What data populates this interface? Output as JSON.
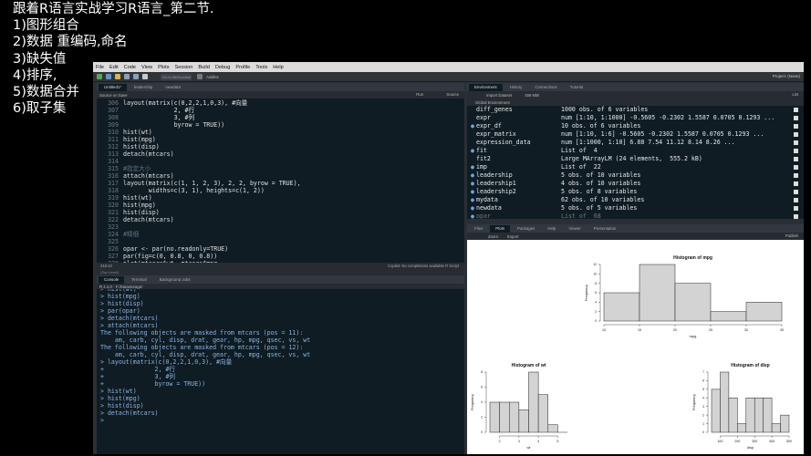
{
  "outline": {
    "title": "跟着R语言实战学习R语言_第二节.",
    "items": [
      "1)图形组合",
      "2)数据 重编码,命名",
      "3)缺失值",
      "4)排序,",
      "5)数据合并",
      "6)取子集"
    ]
  },
  "menu": [
    "File",
    "Edit",
    "Code",
    "View",
    "Plots",
    "Session",
    "Build",
    "Debug",
    "Profile",
    "Tools",
    "Help"
  ],
  "toolbar": {
    "goto_placeholder": "Go to file/function",
    "addins_label": "Addins",
    "project_label": "Project: (None)"
  },
  "editor": {
    "tabs": [
      "Untitled1*",
      "leadership",
      "newdata"
    ],
    "source_on_save": "Source on Save",
    "run_label": "Run",
    "source_label": "Source",
    "lines": [
      {
        "n": "306",
        "t": "layout(matrix(c(0,2,2,1,0,3), #向量"
      },
      {
        "n": "307",
        "t": "              2, #行"
      },
      {
        "n": "308",
        "t": "              3, #列"
      },
      {
        "n": "309",
        "t": "              byrow = TRUE))"
      },
      {
        "n": "310",
        "t": "hist(wt)"
      },
      {
        "n": "311",
        "t": "hist(mpg)"
      },
      {
        "n": "312",
        "t": "hist(disp)"
      },
      {
        "n": "313",
        "t": "detach(mtcars)"
      },
      {
        "n": "314",
        "t": ""
      },
      {
        "n": "315",
        "t": "#指定大小",
        "c": true
      },
      {
        "n": "316",
        "t": "attach(mtcars)"
      },
      {
        "n": "317",
        "t": "layout(matrix(c(1, 1, 2, 3), 2, 2, byrow = TRUE),"
      },
      {
        "n": "318",
        "t": "       widths=c(3, 1), heights=c(1, 2))"
      },
      {
        "n": "319",
        "t": "hist(wt)"
      },
      {
        "n": "320",
        "t": "hist(mpg)"
      },
      {
        "n": "321",
        "t": "hist(disp)"
      },
      {
        "n": "322",
        "t": "detach(mtcars)"
      },
      {
        "n": "323",
        "t": ""
      },
      {
        "n": "324",
        "t": "#精细",
        "c": true
      },
      {
        "n": "325",
        "t": ""
      },
      {
        "n": "326",
        "t": "opar <- par(no.readonly=TRUE)"
      },
      {
        "n": "327",
        "t": "par(fig=c(0, 0.8, 0, 0.8))"
      },
      {
        "n": "328",
        "t": "plot(mtcars$wt, mtcars$mpg,"
      }
    ],
    "status_left": "318:10",
    "status_sub": "(Top Level)",
    "status_right": "Copilot: No completions available    R Script"
  },
  "console": {
    "tabs": [
      "Console",
      "Terminal",
      "Background Jobs"
    ],
    "path": "R 4.4.0 · F:/Datastorage/",
    "lines": [
      "> hist(wt)",
      "> hist(mpg)",
      "> hist(disp)",
      "> par(opar)",
      "> detach(mtcars)",
      "> attach(mtcars)",
      "The following objects are masked from mtcars (pos = 11):",
      "",
      "    am, carb, cyl, disp, drat, gear, hp, mpg, qsec, vs, wt",
      "",
      "The following objects are masked from mtcars (pos = 12):",
      "",
      "    am, carb, cyl, disp, drat, gear, hp, mpg, qsec, vs, wt",
      "",
      "> layout(matrix(c(0,2,2,1,0,3), #向量",
      "+              2, #行",
      "+              3, #列",
      "+              byrow = TRUE))",
      "> hist(wt)",
      "> hist(mpg)",
      "> hist(disp)",
      "> detach(mtcars)",
      "> "
    ]
  },
  "environment": {
    "tabs": [
      "Environment",
      "History",
      "Connections",
      "Tutorial"
    ],
    "import_label": "Import Dataset",
    "memory_label": "458 MiB",
    "scope_label": "Global Environment",
    "list_label": "List",
    "rows": [
      {
        "dot": "",
        "name": "diff_genes",
        "value": "1000 obs. of 6 variables"
      },
      {
        "dot": "",
        "name": "expr",
        "value": "num [1:10, 1:1000] -0.5605 -0.2302 1.5587 0.0705 0.1293 ..."
      },
      {
        "dot": "●",
        "name": "expr_df",
        "value": "10 obs. of 6 variables"
      },
      {
        "dot": "",
        "name": "expr_matrix",
        "value": "num [1:10, 1:6] -0.5605 -0.2302 1.5587 0.0705 0.1293 ..."
      },
      {
        "dot": "",
        "name": "expression_data",
        "value": "num [1:1000, 1:10] 6.88 7.54 11.12 8.14 8.26 ..."
      },
      {
        "dot": "●",
        "name": "fit",
        "value": "List of  4"
      },
      {
        "dot": "",
        "name": "fit2",
        "value": "Large MArrayLM (24 elements,  555.2 kB)"
      },
      {
        "dot": "●",
        "name": "imp",
        "value": "List of  22"
      },
      {
        "dot": "●",
        "name": "leadership",
        "value": "5 obs. of 10 variables"
      },
      {
        "dot": "●",
        "name": "leadership1",
        "value": "4 obs. of 10 variables"
      },
      {
        "dot": "●",
        "name": "leadership2",
        "value": "5 obs. of 8 variables"
      },
      {
        "dot": "●",
        "name": "mydata",
        "value": "62 obs. of 10 variables"
      },
      {
        "dot": "●",
        "name": "newdata",
        "value": "5 obs. of 5 variables"
      },
      {
        "dot": "●",
        "name": "opar",
        "value": "List of  68",
        "dim": true
      }
    ]
  },
  "files": {
    "tabs": [
      "Files",
      "Plots",
      "Packages",
      "Help",
      "Viewer",
      "Presentation"
    ],
    "zoom_label": "Zoom",
    "export_label": "Export",
    "publish_label": "Publish"
  },
  "plots": {
    "mpg": {
      "title": "Histogram of mpg",
      "xlabel": "mpg",
      "ylabel": "Frequency",
      "breaks": [
        10,
        15,
        20,
        25,
        30,
        35
      ],
      "counts": [
        6,
        12,
        8,
        2,
        4
      ],
      "xticks": [
        10,
        15,
        20,
        25,
        30,
        35
      ],
      "yticks": [
        0,
        2,
        4,
        6,
        8,
        10,
        12
      ],
      "ymax": 12
    },
    "wt": {
      "title": "Histogram of wt",
      "xlabel": "wt",
      "ylabel": "Frequency",
      "breaks": [
        1.5,
        2,
        2.5,
        3,
        3.5,
        4,
        4.5,
        5,
        5.5
      ],
      "counts": [
        4,
        4,
        4,
        3,
        8,
        5,
        1,
        0,
        3
      ],
      "xticks": [
        2,
        3,
        4,
        5
      ],
      "yticks": [
        0,
        2,
        4,
        6,
        8
      ],
      "ymax": 8
    },
    "disp": {
      "title": "Histogram of disp",
      "xlabel": "disp",
      "ylabel": "Frequency",
      "breaks": [
        50,
        100,
        150,
        200,
        250,
        300,
        350,
        400,
        450,
        500
      ],
      "counts": [
        5,
        7,
        4,
        1,
        4,
        4,
        4,
        1,
        2
      ],
      "xticks": [
        100,
        200,
        300,
        400,
        500
      ],
      "yticks": [
        0,
        1,
        2,
        3,
        4,
        5,
        6,
        7
      ],
      "ymax": 7
    }
  }
}
